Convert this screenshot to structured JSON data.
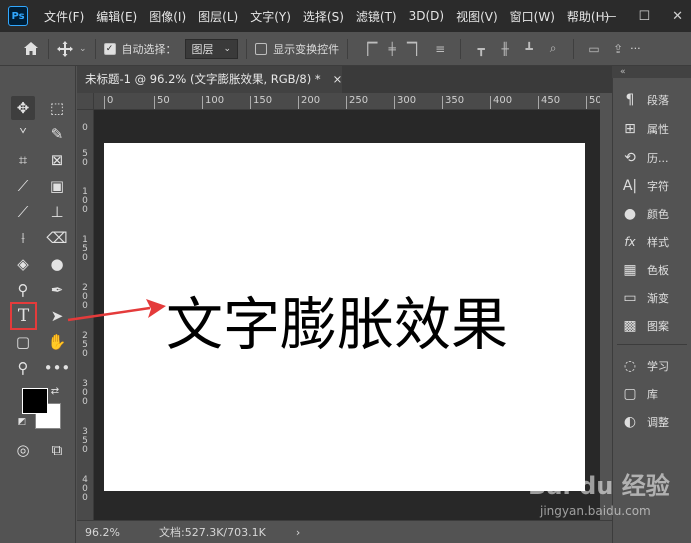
{
  "app": {
    "logo": "Ps"
  },
  "menu": [
    "文件(F)",
    "编辑(E)",
    "图像(I)",
    "图层(L)",
    "文字(Y)",
    "选择(S)",
    "滤镜(T)",
    "3D(D)",
    "视图(V)",
    "窗口(W)",
    "帮助(H)"
  ],
  "window_controls": {
    "minimize": "—",
    "maximize": "☐",
    "close": "✕"
  },
  "options_bar": {
    "auto_select_label": "自动选择：",
    "auto_select_checked": true,
    "auto_select_target": "图层",
    "show_transform_label": "显示变换控件",
    "show_transform_checked": false,
    "more_label": "···"
  },
  "document": {
    "tab_title": "未标题-1 @ 96.2% (文字膨胀效果, RGB/8) *",
    "tab_close": "×",
    "canvas_text": "文字膨胀效果"
  },
  "rulers": {
    "horizontal": [
      "0",
      "50",
      "100",
      "150",
      "200",
      "250",
      "300",
      "350",
      "400",
      "450",
      "50"
    ],
    "vertical": [
      "0",
      "5",
      "0",
      "1",
      "0",
      "0",
      "1",
      "5",
      "0",
      "2",
      "0",
      "0",
      "2",
      "5",
      "0",
      "3",
      "0",
      "0",
      "3",
      "5",
      "0",
      "4",
      "0",
      "0"
    ]
  },
  "status": {
    "zoom": "96.2%",
    "doc_size": "文档:527.3K/703.1K",
    "arrow": "›"
  },
  "right_panel": {
    "group1": [
      {
        "icon": "paragraph-icon",
        "glyph": "¶",
        "label": "段落"
      },
      {
        "icon": "properties-icon",
        "glyph": "⊞",
        "label": "属性"
      },
      {
        "icon": "history-icon",
        "glyph": "⟲",
        "label": "历..."
      },
      {
        "icon": "character-icon",
        "glyph": "A|",
        "label": "字符"
      },
      {
        "icon": "color-icon",
        "glyph": "●",
        "label": "颜色"
      },
      {
        "icon": "styles-icon",
        "glyph": "fx",
        "label": "样式"
      },
      {
        "icon": "swatches-icon",
        "glyph": "▦",
        "label": "色板"
      },
      {
        "icon": "gradient-icon",
        "glyph": "▭",
        "label": "渐变"
      },
      {
        "icon": "patterns-icon",
        "glyph": "▩",
        "label": "图案"
      }
    ],
    "group2": [
      {
        "icon": "learn-icon",
        "glyph": "◌",
        "label": "学习"
      },
      {
        "icon": "libraries-icon",
        "glyph": "▢",
        "label": "库"
      },
      {
        "icon": "adjustments-icon",
        "glyph": "◐",
        "label": "调整"
      }
    ]
  },
  "watermark": {
    "logo": "Bai du 经验",
    "url": "jingyan.baidu.com"
  },
  "colors": {
    "foreground": "#000000",
    "background": "#ffffff",
    "highlight": "#e43b3b"
  }
}
